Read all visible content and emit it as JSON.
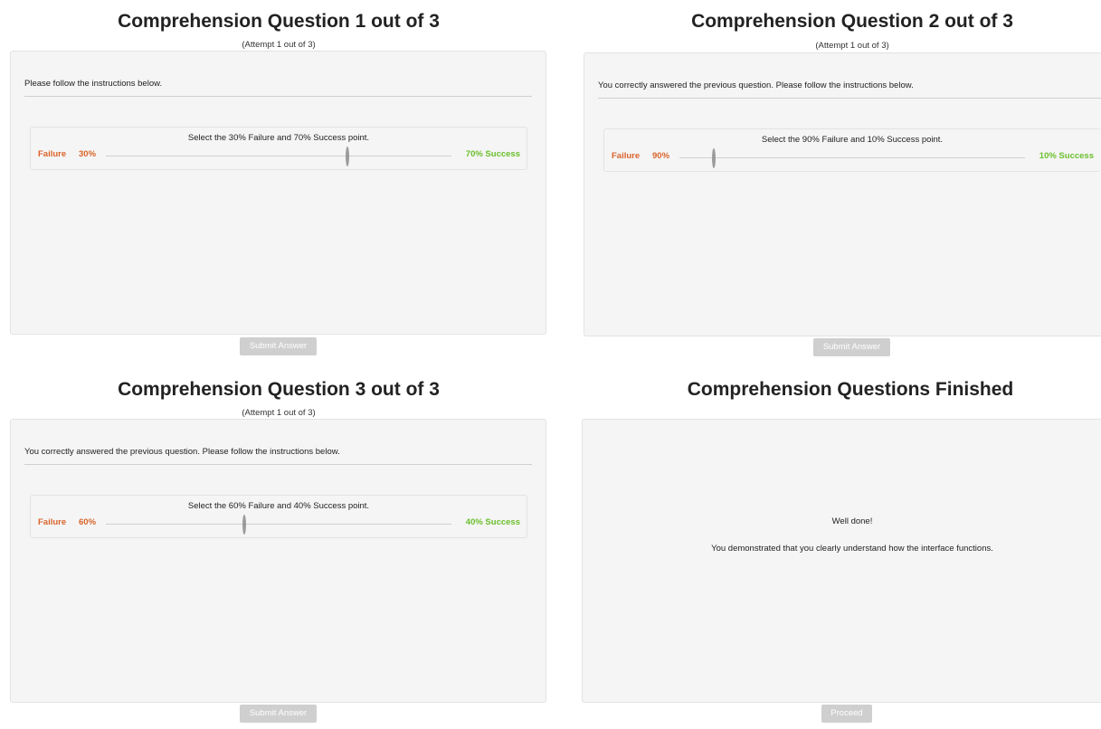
{
  "questions": [
    {
      "title": "Comprehension Question 1 out of 3",
      "attempt": "(Attempt 1 out of 3)",
      "instructions": "Please follow the instructions below.",
      "prompt": "Select the 30% Failure and 70% Success point.",
      "failure_label": "Failure",
      "failure_percent": "30%",
      "success_text": "70% Success",
      "slider_value": 0.7,
      "submit_label": "Submit Answer"
    },
    {
      "title": "Comprehension Question 2 out of 3",
      "attempt": "(Attempt 1 out of 3)",
      "instructions": "You correctly answered the previous question. Please follow the instructions below.",
      "prompt": "Select the 90% Failure and 10% Success point.",
      "failure_label": "Failure",
      "failure_percent": "90%",
      "success_text": "10% Success",
      "slider_value": 0.1,
      "submit_label": "Submit Answer"
    },
    {
      "title": "Comprehension Question 3 out of 3",
      "attempt": "(Attempt 1 out of 3)",
      "instructions": "You correctly answered the previous question. Please follow the instructions below.",
      "prompt": "Select the 60% Failure and 40% Success point.",
      "failure_label": "Failure",
      "failure_percent": "60%",
      "success_text": "40% Success",
      "slider_value": 0.4,
      "submit_label": "Submit Answer"
    }
  ],
  "finished": {
    "title": "Comprehension Questions Finished",
    "message_1": "Well done!",
    "message_2": "You demonstrated that you clearly understand how the interface functions.",
    "proceed_label": "Proceed"
  },
  "colors": {
    "failure": "#d9642a",
    "success": "#6abf2b",
    "panel_bg": "#f5f5f5",
    "button_disabled": "#cfcfcf"
  }
}
